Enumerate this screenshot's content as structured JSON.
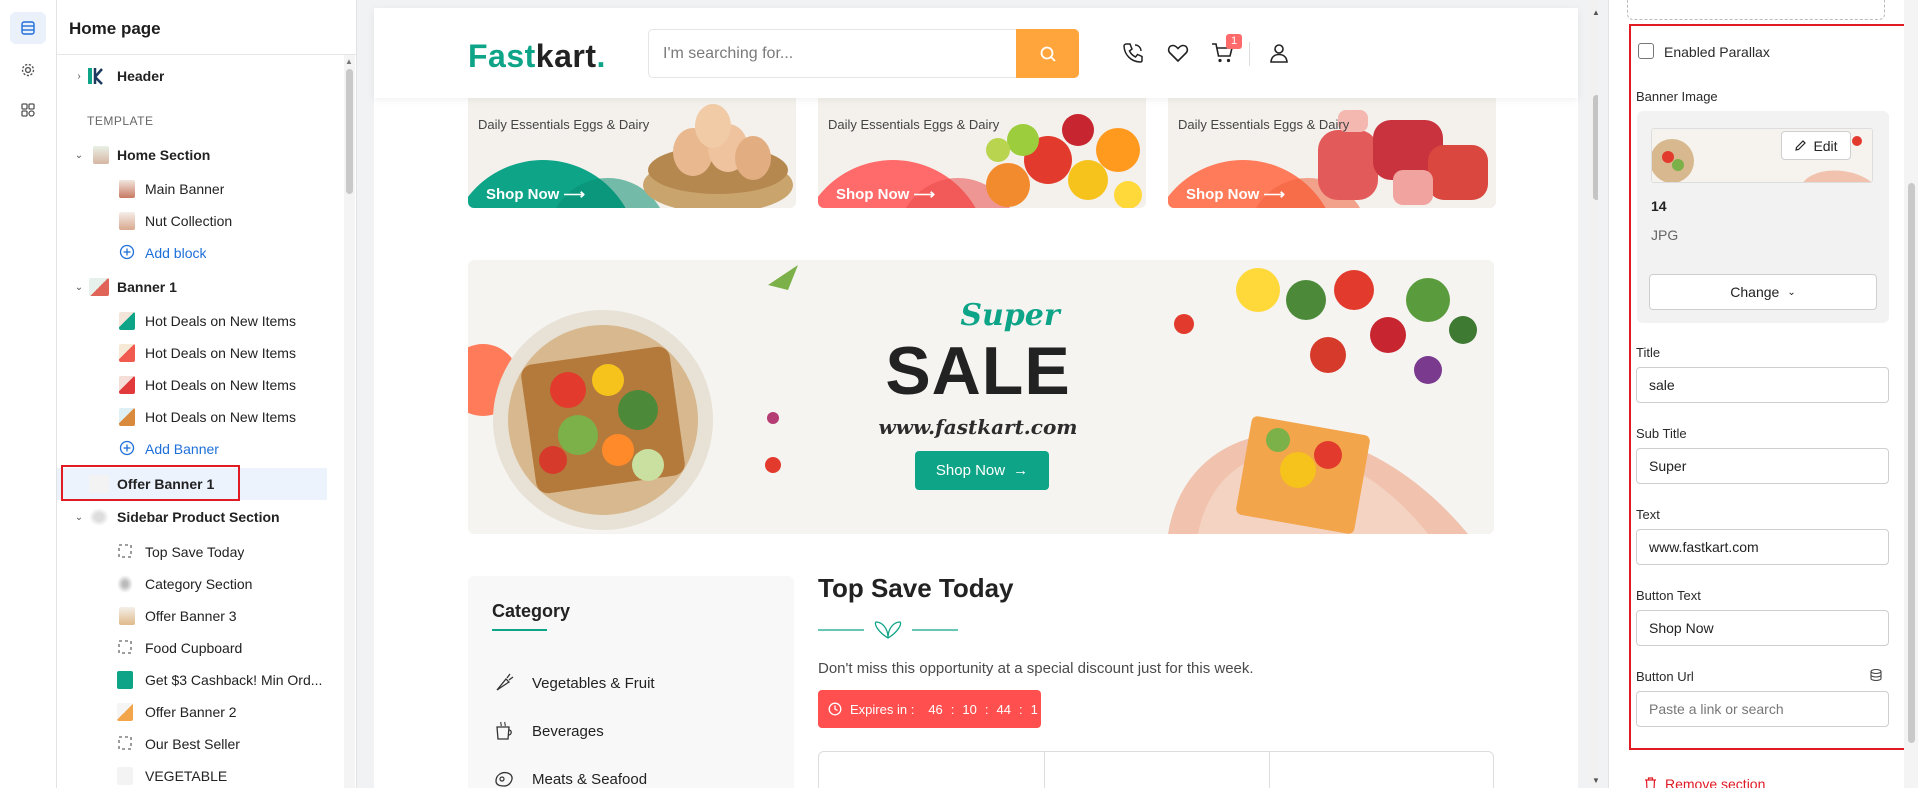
{
  "tree": {
    "title": "Home page",
    "template_caption": "TEMPLATE",
    "header_item": "Header",
    "home_section": {
      "label": "Home Section",
      "blocks": [
        "Main Banner",
        "Nut Collection"
      ],
      "add_label": "Add block"
    },
    "banner1": {
      "label": "Banner 1",
      "items": [
        "Hot Deals on New Items",
        "Hot Deals on New Items",
        "Hot Deals on New Items",
        "Hot Deals on New Items"
      ],
      "add_label": "Add Banner"
    },
    "offer_banner": "Offer Banner 1",
    "sidebar_section": {
      "label": "Sidebar Product Section",
      "items": [
        "Top Save Today",
        "Category Section",
        "Offer Banner 3",
        "Food Cupboard",
        "Get $3 Cashback! Min Ord...",
        "Offer Banner 2",
        "Our Best Seller",
        "VEGETABLE"
      ]
    }
  },
  "preview": {
    "logo": {
      "part1": "Fast",
      "part2": "kart",
      "part3": "."
    },
    "search_placeholder": "I'm searching for...",
    "cart_count": "1",
    "cards": [
      {
        "caption": "Daily Essentials Eggs & Dairy",
        "button": "Shop Now"
      },
      {
        "caption": "Daily Essentials Eggs & Dairy",
        "button": "Shop Now"
      },
      {
        "caption": "Daily Essentials Eggs & Dairy",
        "button": "Shop Now"
      }
    ],
    "sale": {
      "super": "Super",
      "big": "SALE",
      "url": "www.fastkart.com",
      "button": "Shop Now"
    },
    "category": {
      "title": "Category",
      "items": [
        "Vegetables & Fruit",
        "Beverages",
        "Meats & Seafood"
      ]
    },
    "top_save": {
      "title": "Top Save Today",
      "description": "Don't miss this opportunity at a special discount just for this week.",
      "expires_label": "Expires in :",
      "timer": [
        "46",
        "10",
        "44",
        "1"
      ]
    }
  },
  "settings": {
    "parallax_label": "Enabled Parallax",
    "parallax_checked": false,
    "banner_image_label": "Banner Image",
    "edit_label": "Edit",
    "image_name": "14",
    "image_ext": "JPG",
    "change_label": "Change",
    "title_label": "Title",
    "title_value": "sale",
    "subtitle_label": "Sub Title",
    "subtitle_value": "Super",
    "text_label": "Text",
    "text_value": "www.fastkart.com",
    "button_text_label": "Button Text",
    "button_text_value": "Shop Now",
    "button_url_label": "Button Url",
    "button_url_placeholder": "Paste a link or search",
    "remove_label": "Remove section"
  },
  "colors": {
    "brand": "#0da487",
    "accent_orange": "#ffa53b",
    "highlight_red": "#e01b24",
    "timer_red": "#ff4f4f"
  }
}
